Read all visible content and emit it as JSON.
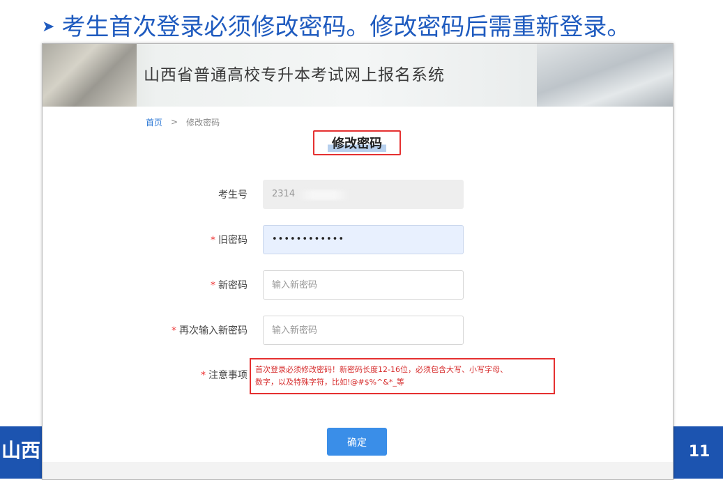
{
  "slide": {
    "heading": "考生首次登录必须修改密码。修改密码后需重新登录。",
    "footer_left": "山西",
    "page_number": "11"
  },
  "banner": {
    "title": "山西省普通高校专升本考试网上报名系统"
  },
  "breadcrumb": {
    "home": "首页",
    "separator": ">",
    "current": "修改密码"
  },
  "form": {
    "heading": "修改密码",
    "student_id": {
      "label": "考生号",
      "value": "2314"
    },
    "old_password": {
      "required_mark": "*",
      "label": "旧密码",
      "value": "••••••••••••"
    },
    "new_password": {
      "required_mark": "*",
      "label": "新密码",
      "placeholder": "输入新密码"
    },
    "confirm_password": {
      "required_mark": "*",
      "label": "再次输入新密码",
      "placeholder": "输入新密码"
    },
    "notes": {
      "required_mark": "*",
      "label": "注意事项",
      "line1": "首次登录必须修改密码！新密码长度12-16位，必须包含大写、小写字母、",
      "line2": "数字，以及特殊字符，比如!@#$%^&*_等"
    },
    "submit_label": "确定"
  },
  "colors": {
    "accent_blue": "#1f5bbf",
    "band_blue": "#1c54b0",
    "button_blue": "#3a8ee8",
    "highlight_red": "#e53030"
  }
}
